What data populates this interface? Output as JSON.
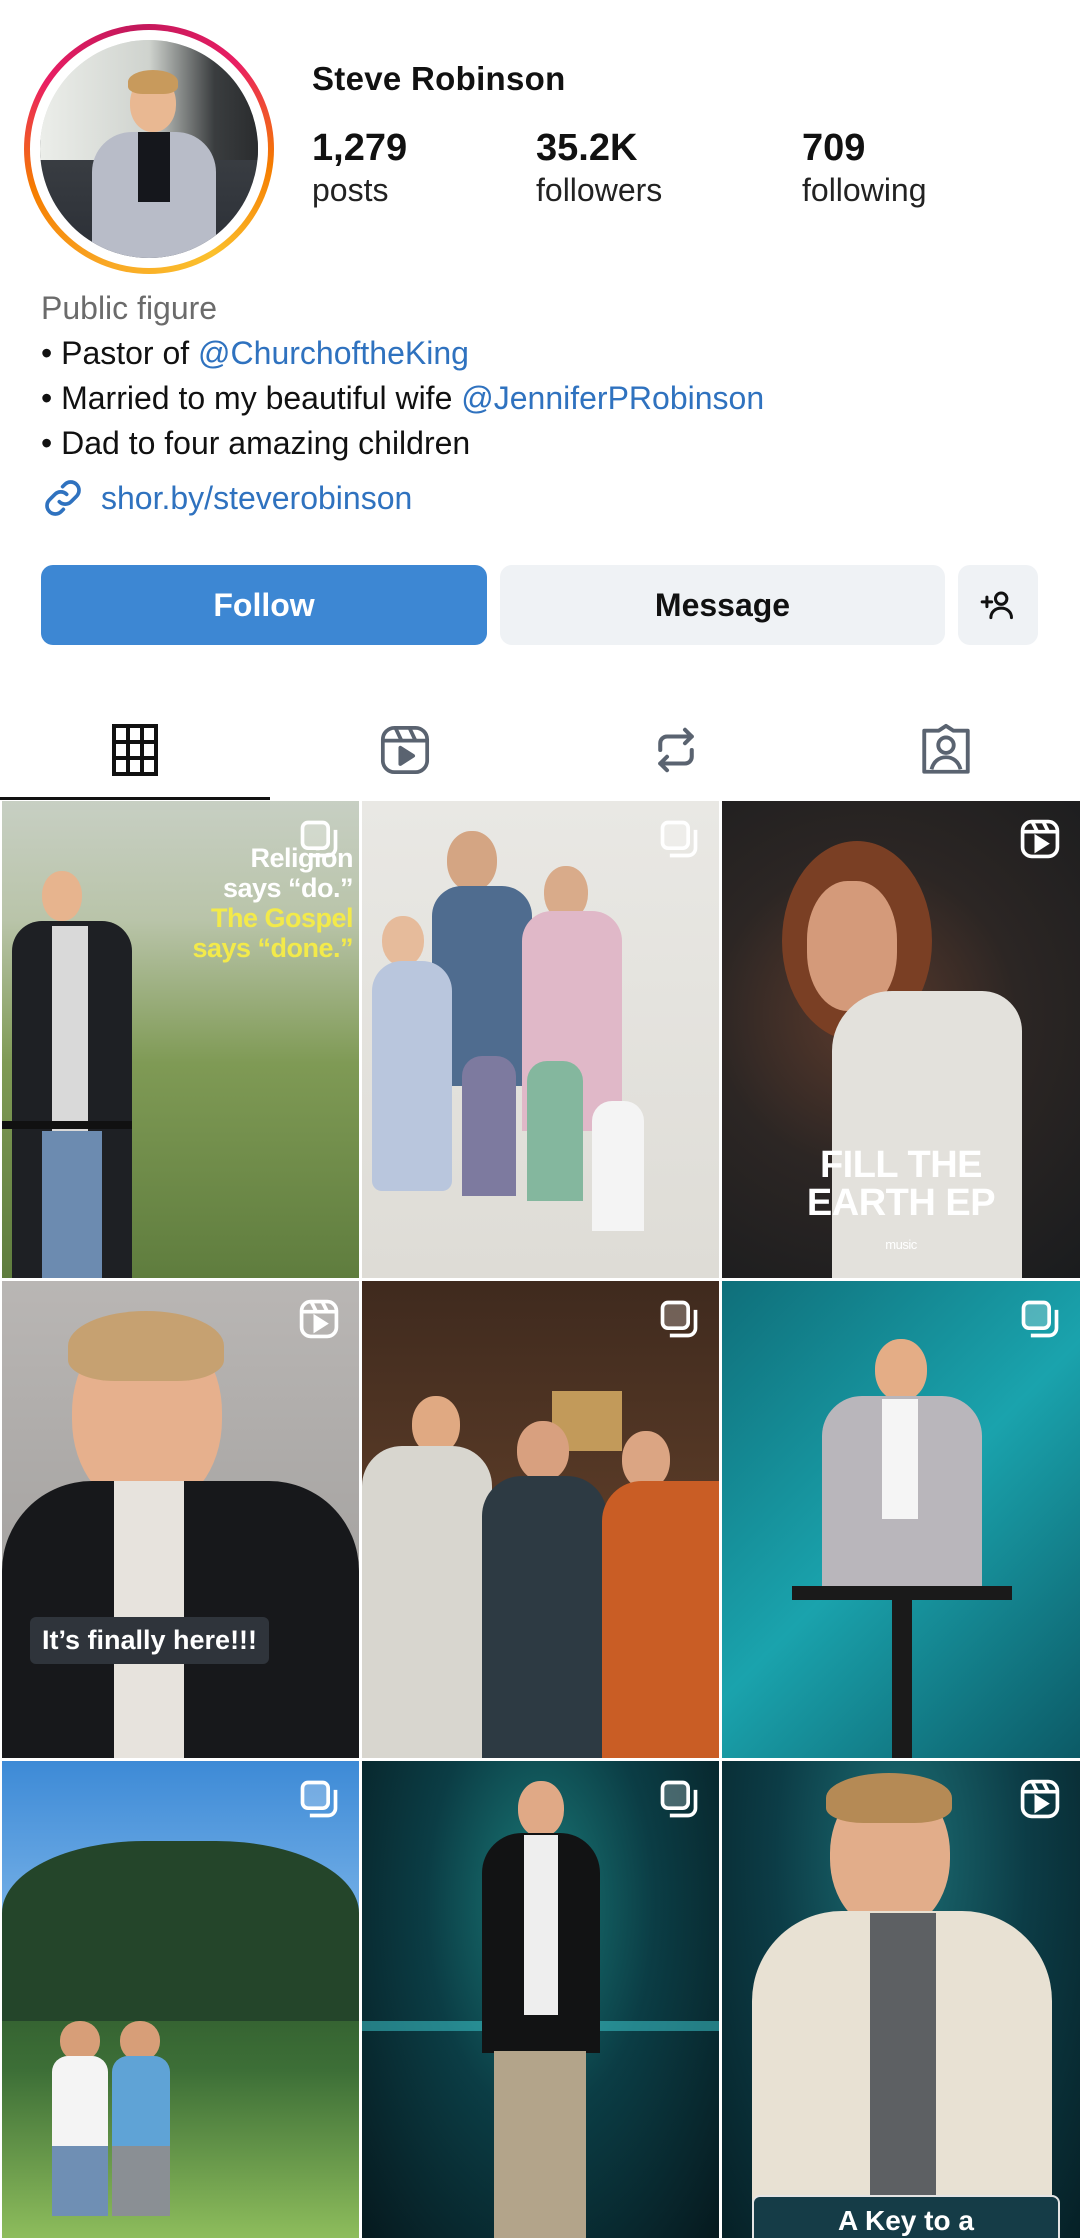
{
  "profile": {
    "username": "Steve Robinson",
    "posts_count": "1,279",
    "posts_label": "posts",
    "followers_count": "35.2K",
    "followers_label": "followers",
    "following_count": "709",
    "following_label": "following",
    "category": "Public figure",
    "bio_lines": [
      {
        "prefix": "• Pastor of ",
        "mention": "@ChurchoftheKing"
      },
      {
        "prefix": "• Married to my beautiful wife ",
        "mention": "@JenniferPRobinson"
      },
      {
        "prefix": "• Dad to four amazing children",
        "mention": ""
      }
    ],
    "link": "shor.by/steverobinson"
  },
  "actions": {
    "follow_label": "Follow",
    "message_label": "Message",
    "add_icon": "add-person-icon"
  },
  "tabs": [
    {
      "icon": "grid-icon",
      "active": true
    },
    {
      "icon": "reels-icon",
      "active": false
    },
    {
      "icon": "reposts-icon",
      "active": false
    },
    {
      "icon": "tagged-icon",
      "active": false
    }
  ],
  "posts": [
    {
      "type": "carousel",
      "text_lines": [
        "Religion",
        "says “do.”",
        "The Gospel",
        "says “done.”"
      ]
    },
    {
      "type": "carousel",
      "text_lines": []
    },
    {
      "type": "reel",
      "text_lines": [
        "FILL THE",
        "EARTH EP"
      ],
      "sub": "music"
    },
    {
      "type": "reel",
      "text_lines": [
        "It’s finally here!!!"
      ]
    },
    {
      "type": "carousel",
      "text_lines": []
    },
    {
      "type": "carousel",
      "text_lines": []
    },
    {
      "type": "carousel",
      "text_lines": []
    },
    {
      "type": "carousel",
      "text_lines": []
    },
    {
      "type": "reel",
      "text_lines": [
        "A Key to a"
      ]
    }
  ],
  "colors": {
    "link_blue": "#2f72bf",
    "follow_blue": "#3d87d3",
    "secondary_button": "#eff2f5"
  }
}
